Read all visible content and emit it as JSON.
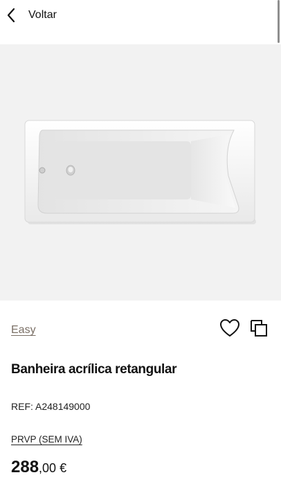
{
  "nav": {
    "back_label": "Voltar"
  },
  "product": {
    "collection": "Easy",
    "title": "Banheira acrílica retangular",
    "ref": "REF: A248149000",
    "price_label": "PRVP (SEM IVA)",
    "price": {
      "integer": "288",
      "decimals": ",00",
      "currency": " €"
    }
  },
  "icons": {
    "back": "chevron-left-icon",
    "favorite": "heart-outline-icon",
    "compare": "compare-squares-icon"
  },
  "colors": {
    "collection_link": "#7a6f65",
    "hero_background": "#f2f2f2",
    "text": "#111111"
  }
}
